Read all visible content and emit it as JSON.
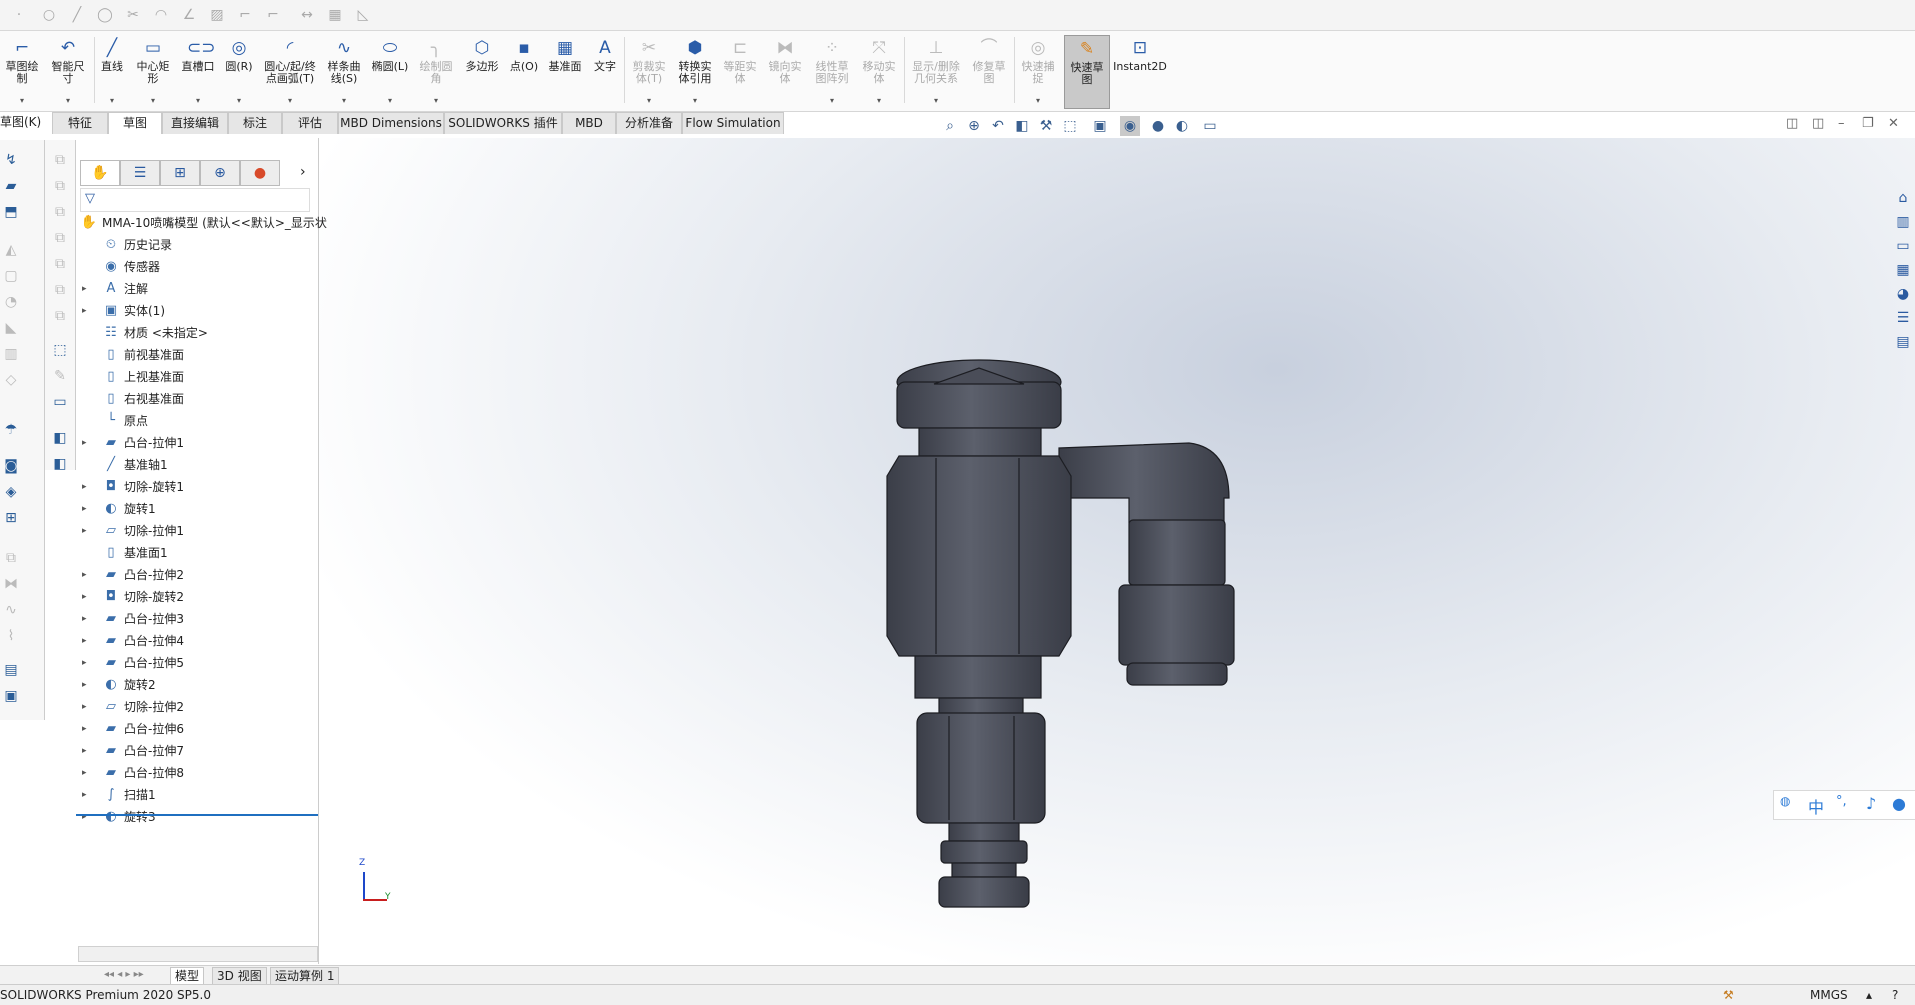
{
  "ribbon": {
    "items": [
      {
        "label": "草图绘\n制",
        "icon": "sketch-icon"
      },
      {
        "label": "智能尺\n寸",
        "icon": "smart-dimension-icon"
      },
      {
        "label": "直线",
        "icon": "line-icon"
      },
      {
        "label": "中心矩\n形",
        "icon": "center-rectangle-icon"
      },
      {
        "label": "直槽口",
        "icon": "straight-slot-icon"
      },
      {
        "label": "圆(R)",
        "icon": "circle-icon"
      },
      {
        "label": "圆心/起/终\n点画弧(T)",
        "icon": "arc-icon"
      },
      {
        "label": "样条曲\n线(S)",
        "icon": "spline-icon"
      },
      {
        "label": "椭圆(L)",
        "icon": "ellipse-icon"
      },
      {
        "label": "绘制圆\n角",
        "icon": "fillet-icon"
      },
      {
        "label": "多边形",
        "icon": "polygon-icon"
      },
      {
        "label": "点(O)",
        "icon": "point-icon"
      },
      {
        "label": "基准面",
        "icon": "plane-icon"
      },
      {
        "label": "文字",
        "icon": "text-icon"
      },
      {
        "label": "剪裁实\n体(T)",
        "icon": "trim-icon"
      },
      {
        "label": "转换实\n体引用",
        "icon": "convert-entities-icon"
      },
      {
        "label": "等距实\n体",
        "icon": "offset-icon"
      },
      {
        "label": "镜向实\n体",
        "icon": "mirror-icon"
      },
      {
        "label": "线性草\n图阵列",
        "icon": "linear-pattern-icon"
      },
      {
        "label": "移动实\n体",
        "icon": "move-icon"
      },
      {
        "label": "显示/删除\n几何关系",
        "icon": "relations-icon"
      },
      {
        "label": "修复草\n图",
        "icon": "repair-icon"
      },
      {
        "label": "快速捕\n捉",
        "icon": "snap-icon"
      },
      {
        "label": "快速草\n图",
        "icon": "rapid-sketch-icon"
      },
      {
        "label": "Instant2D",
        "icon": "instant2d-icon"
      }
    ]
  },
  "tabs": [
    "草图(K)",
    "特征",
    "草图",
    "直接编辑",
    "标注",
    "评估",
    "MBD Dimensions",
    "SOLIDWORKS 插件",
    "MBD",
    "分析准备",
    "Flow Simulation"
  ],
  "tree": {
    "root": "MMA-10喷嘴模型 (默认<<默认>_显示状",
    "items": [
      {
        "label": "历史记录",
        "icon": "history-icon",
        "exp": ""
      },
      {
        "label": "传感器",
        "icon": "sensor-icon",
        "exp": ""
      },
      {
        "label": "注解",
        "icon": "annotation-icon",
        "exp": "▸"
      },
      {
        "label": "实体(1)",
        "icon": "solid-bodies-icon",
        "exp": "▸"
      },
      {
        "label": "材质 <未指定>",
        "icon": "material-icon",
        "exp": ""
      },
      {
        "label": "前视基准面",
        "icon": "plane-icon",
        "exp": ""
      },
      {
        "label": "上视基准面",
        "icon": "plane-icon",
        "exp": ""
      },
      {
        "label": "右视基准面",
        "icon": "plane-icon",
        "exp": ""
      },
      {
        "label": "原点",
        "icon": "origin-icon",
        "exp": ""
      },
      {
        "label": "凸台-拉伸1",
        "icon": "extrude-icon",
        "exp": "▸"
      },
      {
        "label": "基准轴1",
        "icon": "axis-icon",
        "exp": ""
      },
      {
        "label": "切除-旋转1",
        "icon": "cut-revolve-icon",
        "exp": "▸"
      },
      {
        "label": "旋转1",
        "icon": "revolve-icon",
        "exp": "▸"
      },
      {
        "label": "切除-拉伸1",
        "icon": "cut-extrude-icon",
        "exp": "▸"
      },
      {
        "label": "基准面1",
        "icon": "plane-icon",
        "exp": ""
      },
      {
        "label": "凸台-拉伸2",
        "icon": "extrude-icon",
        "exp": "▸"
      },
      {
        "label": "切除-旋转2",
        "icon": "cut-revolve-icon",
        "exp": "▸"
      },
      {
        "label": "凸台-拉伸3",
        "icon": "extrude-icon",
        "exp": "▸"
      },
      {
        "label": "凸台-拉伸4",
        "icon": "extrude-icon",
        "exp": "▸"
      },
      {
        "label": "凸台-拉伸5",
        "icon": "extrude-icon",
        "exp": "▸"
      },
      {
        "label": "旋转2",
        "icon": "revolve-icon",
        "exp": "▸"
      },
      {
        "label": "切除-拉伸2",
        "icon": "cut-extrude-icon",
        "exp": "▸"
      },
      {
        "label": "凸台-拉伸6",
        "icon": "extrude-icon",
        "exp": "▸"
      },
      {
        "label": "凸台-拉伸7",
        "icon": "extrude-icon",
        "exp": "▸"
      },
      {
        "label": "凸台-拉伸8",
        "icon": "extrude-icon",
        "exp": "▸"
      },
      {
        "label": "扫描1",
        "icon": "sweep-icon",
        "exp": "▸"
      },
      {
        "label": "旋转3",
        "icon": "revolve-icon",
        "exp": "▸"
      }
    ]
  },
  "bottom_tabs": [
    "模型",
    "3D 视图",
    "运动算例 1"
  ],
  "status": {
    "app": "SOLIDWORKS Premium 2020 SP5.0",
    "units": "MMGS"
  },
  "triad": {
    "z": "Z",
    "y": "Y"
  },
  "ime": {
    "lang": "中",
    "punct": "°,"
  }
}
